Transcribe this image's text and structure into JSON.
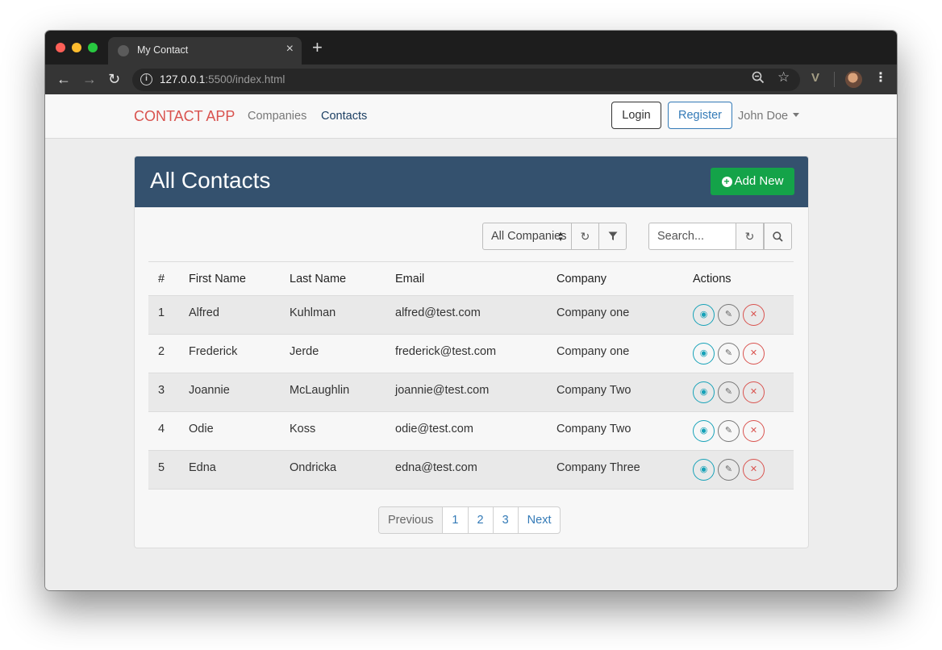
{
  "browser": {
    "tab_title": "My Contact",
    "url_host": "127.0.0.1",
    "url_rest": ":5500/index.html"
  },
  "navbar": {
    "brand": "CONTACT APP",
    "links": [
      "Companies",
      "Contacts"
    ],
    "login": "Login",
    "register": "Register",
    "user": "John Doe"
  },
  "panel": {
    "title": "All Contacts",
    "add_button": "Add New"
  },
  "filters": {
    "company_select": "All Companies",
    "search_placeholder": "Search..."
  },
  "table": {
    "headers": [
      "#",
      "First Name",
      "Last Name",
      "Email",
      "Company",
      "Actions"
    ],
    "rows": [
      {
        "num": "1",
        "first": "Alfred",
        "last": "Kuhlman",
        "email": "alfred@test.com",
        "company": "Company one"
      },
      {
        "num": "2",
        "first": "Frederick",
        "last": "Jerde",
        "email": "frederick@test.com",
        "company": "Company one"
      },
      {
        "num": "3",
        "first": "Joannie",
        "last": "McLaughlin",
        "email": "joannie@test.com",
        "company": "Company Two"
      },
      {
        "num": "4",
        "first": "Odie",
        "last": "Koss",
        "email": "odie@test.com",
        "company": "Company Two"
      },
      {
        "num": "5",
        "first": "Edna",
        "last": "Ondricka",
        "email": "edna@test.com",
        "company": "Company Three"
      }
    ]
  },
  "pagination": [
    "Previous",
    "1",
    "2",
    "3",
    "Next"
  ],
  "colors": {
    "brand": "#d9534f",
    "panel_header": "#34516e",
    "add_button": "#14a349",
    "view_action": "#17a2b8",
    "delete_action": "#d9534f",
    "link": "#337ab7"
  }
}
